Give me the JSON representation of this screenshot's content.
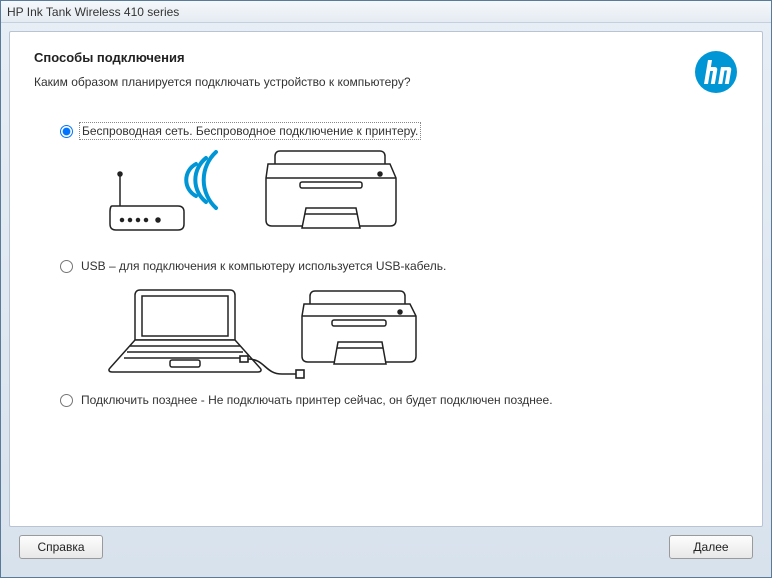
{
  "window": {
    "title": "HP Ink Tank Wireless 410 series"
  },
  "header": {
    "title": "Способы подключения",
    "subtitle": "Каким образом планируется подключать устройство к компьютеру?"
  },
  "options": {
    "wireless": {
      "label": "Беспроводная сеть. Беспроводное подключение к принтеру.",
      "selected": true
    },
    "usb": {
      "label": "USB – для подключения к компьютеру используется USB-кабель.",
      "selected": false
    },
    "later": {
      "label": "Подключить позднее - Не подключать принтер сейчас, он будет подключен  позднее.",
      "selected": false
    }
  },
  "buttons": {
    "help": "Справка",
    "next": "Далее"
  },
  "brand": {
    "logo_label": "HP"
  }
}
